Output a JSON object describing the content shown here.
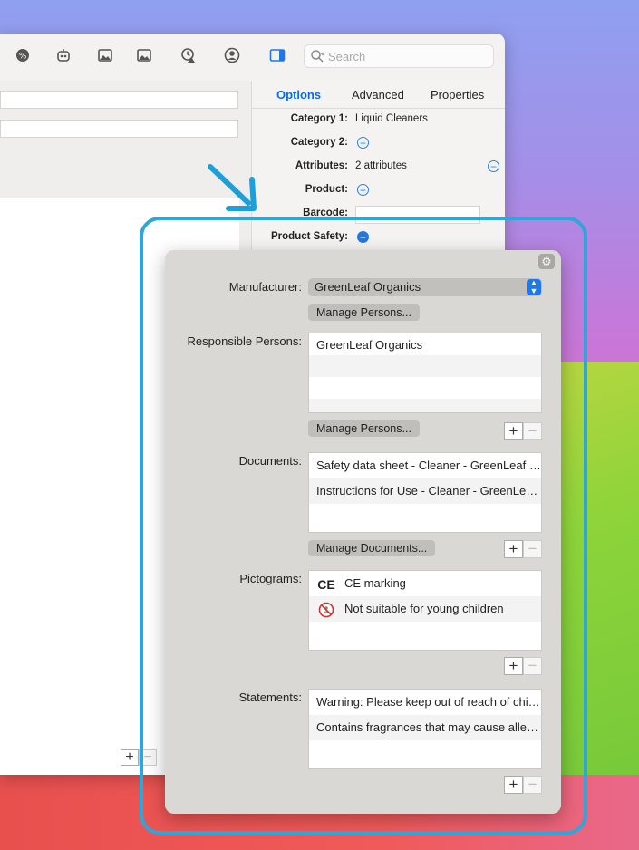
{
  "toolbar": {
    "search_placeholder": "Search"
  },
  "inspector": {
    "tabs": [
      "Options",
      "Advanced",
      "Properties"
    ],
    "active_tab": "Options",
    "rows": {
      "category1_label": "Category 1:",
      "category1_value": "Liquid Cleaners",
      "category2_label": "Category 2:",
      "attributes_label": "Attributes:",
      "attributes_value": "2 attributes",
      "product_label": "Product:",
      "barcode_label": "Barcode:",
      "product_safety_label": "Product Safety:"
    }
  },
  "popover": {
    "manufacturer_label": "Manufacturer:",
    "manufacturer_value": "GreenLeaf Organics",
    "manage_persons_1": "Manage Persons...",
    "responsible_persons_label": "Responsible Persons:",
    "responsible_persons": [
      "GreenLeaf Organics",
      "",
      "",
      ""
    ],
    "manage_persons_2": "Manage Persons...",
    "documents_label": "Documents:",
    "documents": [
      "Safety data sheet - Cleaner - GreenLeaf Organics",
      "Instructions for Use - Cleaner - GreenLeaf Organics",
      ""
    ],
    "manage_documents": "Manage Documents...",
    "pictograms_label": "Pictograms:",
    "pictograms": [
      {
        "icon": "ce-marking-icon",
        "label": "CE marking"
      },
      {
        "icon": "not-suitable-children-icon",
        "label": "Not suitable for young children"
      }
    ],
    "statements_label": "Statements:",
    "statements": [
      "Warning: Please keep out of reach of children.",
      "Contains fragrances that may cause allergic reactions.",
      ""
    ]
  },
  "colors": {
    "accent": "#1e78e8",
    "highlight_frame": "#2ea6d9"
  }
}
